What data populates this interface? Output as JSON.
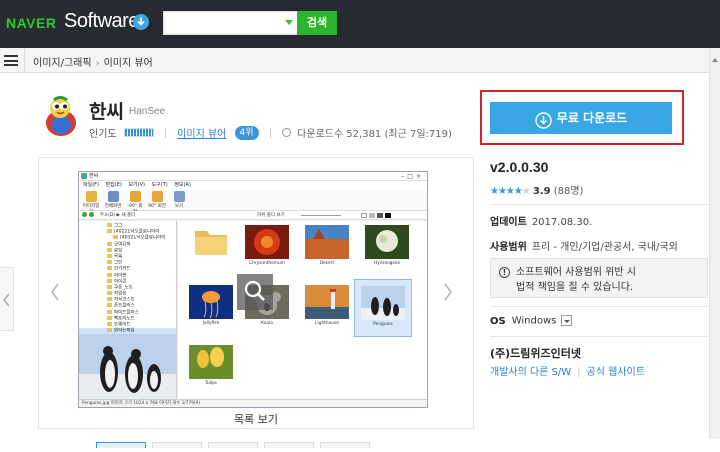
{
  "header": {
    "naver_logo": "NAVER",
    "software_logo": "Software",
    "search": {
      "value": "",
      "placeholder": ""
    },
    "search_button": "검색"
  },
  "nav": {
    "breadcrumb": [
      "이미지/그래픽",
      "이미지 뷰어"
    ]
  },
  "app": {
    "title": "한씨",
    "subtitle": "HanSee",
    "popularity_label": "인기도",
    "category": "이미지 뷰어",
    "rank": "4위",
    "downloads": "다운로드수 52,381 (최근 7일:719)"
  },
  "gallery": {
    "caption": "목록 보기",
    "screenshot": {
      "title": "한씨",
      "menu": [
        "파일(F)",
        "편집(E)",
        "보기(V)",
        "도구(T)",
        "정보(A)"
      ],
      "tools": [
        "이미지열기",
        "전체화면",
        "-90° 회전",
        "90° 회전",
        "보기"
      ],
      "address": "주소(D) ▶ 새 폴더",
      "checkbox": "하위 폴더 보기",
      "tree": [
        "그그",
        "[4022],낙오클로니아이",
        "[4032],낙오클로니아이",
        "공여뮤직",
        "로딩",
        "목록",
        "그인",
        "인기카드",
        "아이썬",
        "아이콘",
        "쿠폰_노트",
        "작업용",
        "자식코스트",
        "폰트플러스",
        "파이드플러스",
        "팩토리노드",
        "트웨이드",
        "원하는파일",
        "서피플러스",
        "한국원드소프트웨"
      ],
      "thumbnails": [
        "",
        "Chrysanthemum",
        "Desert",
        "Hydrangeas",
        "Jellyfish",
        "Koala",
        "Lighthouse",
        "Penguins",
        "Tulips"
      ],
      "status": "Penguins.jpg    이미지 크기 1024 x 768    이미지 개수 1/779(9)"
    }
  },
  "download": {
    "label": "무료 다운로드"
  },
  "info": {
    "version": "v2.0.0.30",
    "rating": {
      "value": 3.9,
      "display": "3.9",
      "count": "(88명)",
      "stars_full": 4,
      "stars_total": 5
    },
    "update": {
      "label": "업데이트",
      "value": "2017.08.30."
    },
    "usage": {
      "label": "사용범위",
      "value": "프리 - 개인/기업/관공서, 국내/국외"
    },
    "warning": {
      "line1": "소프트웨어 사용범위 위반 시",
      "line2": "법적 책임을 질 수 있습니다."
    },
    "os": {
      "label": "OS",
      "value": "Windows"
    },
    "company": "(주)드림위즈인터넷",
    "links": [
      "개발사의 다른 S/W",
      "공식 웹사이트"
    ]
  },
  "colors": {
    "header_bg": "#272a30",
    "naver_green": "#2ccc2c",
    "accent_blue": "#39a6e5",
    "highlight_red": "#c8282a"
  }
}
